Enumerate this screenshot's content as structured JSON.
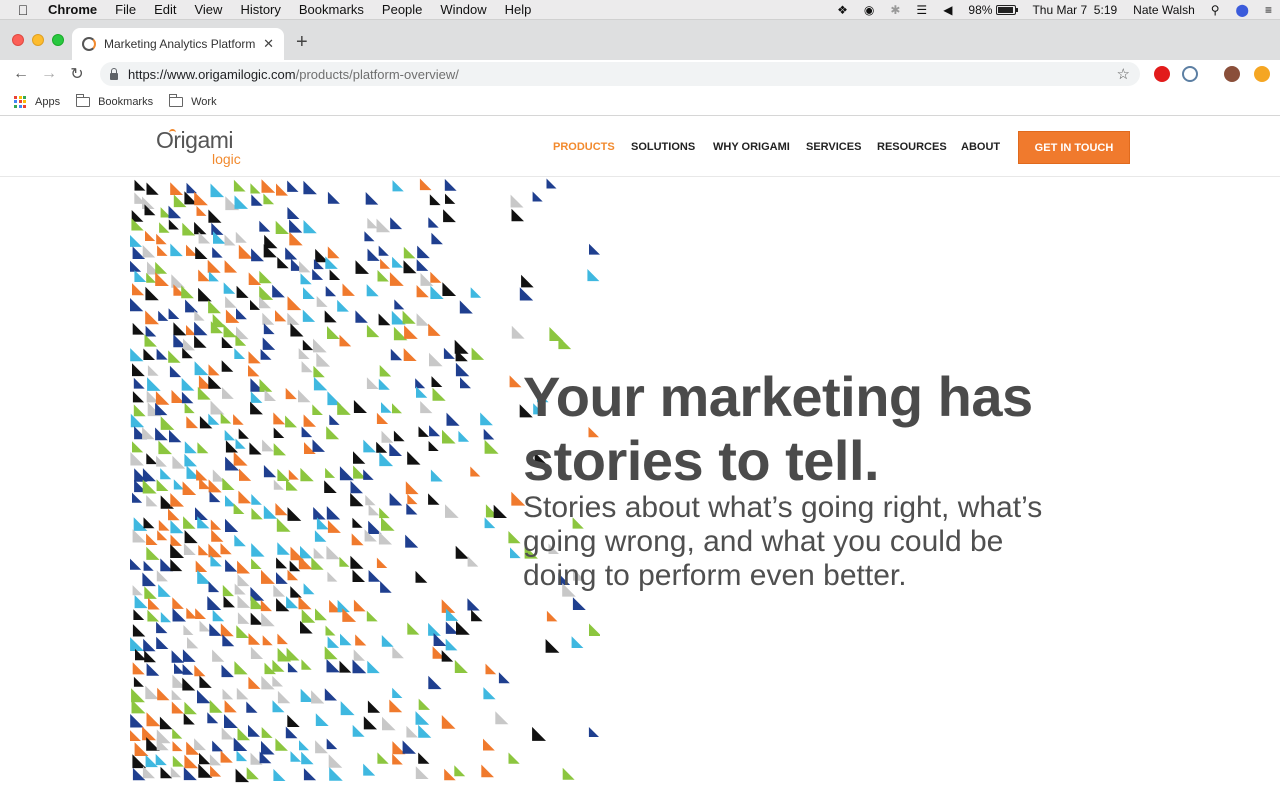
{
  "menubar": {
    "app_name": "Chrome",
    "items": [
      "File",
      "Edit",
      "View",
      "History",
      "Bookmarks",
      "People",
      "Window",
      "Help"
    ],
    "battery": "98%",
    "datetime": "Thu Mar 7  5:19",
    "user": "Nate Walsh"
  },
  "browser": {
    "tab_title": "Marketing Analytics Platform |",
    "url_host": "https://www.origamilogic.com",
    "url_path": "/products/platform-overview/",
    "bookmarks": [
      "Apps",
      "Bookmarks",
      "Work"
    ]
  },
  "site": {
    "logo_top": "Origami",
    "logo_bottom": "logic",
    "nav": [
      "PRODUCTS",
      "SOLUTIONS",
      "WHY ORIGAMI",
      "SERVICES",
      "RESOURCES",
      "ABOUT"
    ],
    "active_nav": "PRODUCTS",
    "cta": "GET IN TOUCH",
    "hero_title": [
      "Your marketing has",
      "stories to tell."
    ],
    "hero_subtitle": [
      "Stories about what’s going right, what’s",
      "going wrong, and what you could be",
      "doing to perform even better."
    ]
  },
  "colors": {
    "accent": "#f07a2d",
    "triangle_palette": [
      "#f07a2d",
      "#8cc63f",
      "#3fb8e0",
      "#1f3f8f",
      "#111111",
      "#c8c8c8"
    ]
  }
}
